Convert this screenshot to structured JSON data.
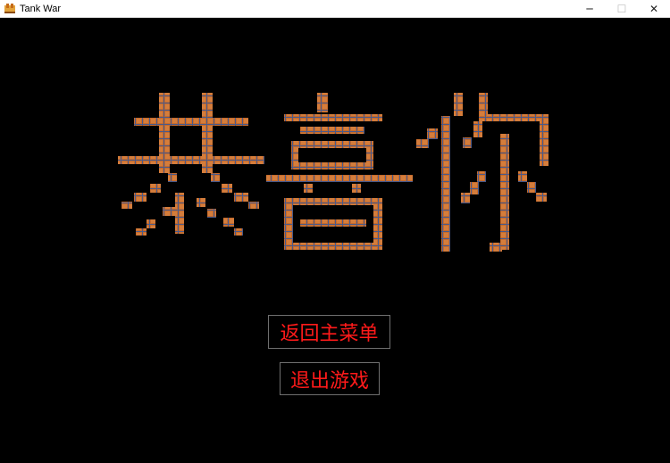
{
  "window": {
    "title": "Tank War",
    "app_icon": "tank-app-icon",
    "controls": [
      "minimize-icon",
      "maximize-icon",
      "close-icon"
    ]
  },
  "game": {
    "banner_text": "恭喜你",
    "banner_style": "brick-tile pixel letters",
    "brick_color": "#c46a2c",
    "background_color": "#000000",
    "buttons": {
      "return_main_menu": "返回主菜单",
      "exit_game": "退出游戏"
    },
    "button_text_color": "#ff1a1a"
  }
}
